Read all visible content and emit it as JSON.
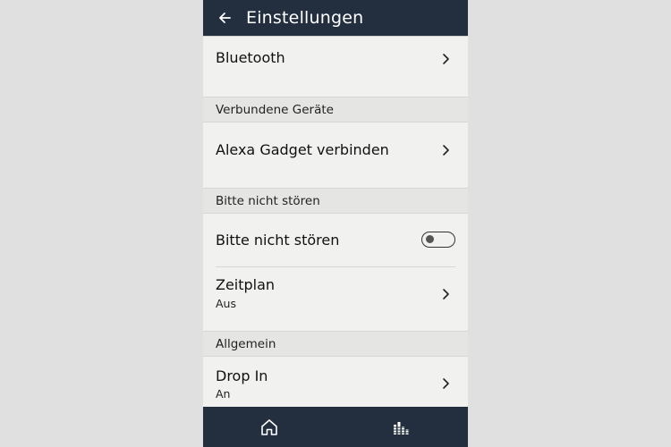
{
  "header": {
    "title": "Einstellungen",
    "back_icon": "arrow-left-icon"
  },
  "colors": {
    "bar": "#232f3e",
    "background": "#f1f1ef",
    "section": "#e5e5e3"
  },
  "items": {
    "bluetooth": {
      "label": "Bluetooth"
    },
    "gadget": {
      "label": "Alexa Gadget verbinden"
    },
    "dnd_toggle": {
      "label": "Bitte nicht stören",
      "enabled": false
    },
    "schedule": {
      "label": "Zeitplan",
      "value": "Aus"
    },
    "dropin": {
      "label": "Drop In",
      "value": "An"
    }
  },
  "sections": {
    "connected": "Verbundene Geräte",
    "dnd": "Bitte nicht stören",
    "general": "Allgemein"
  },
  "bottom_nav": {
    "home_icon": "home-icon",
    "equalizer_icon": "equalizer-icon"
  }
}
